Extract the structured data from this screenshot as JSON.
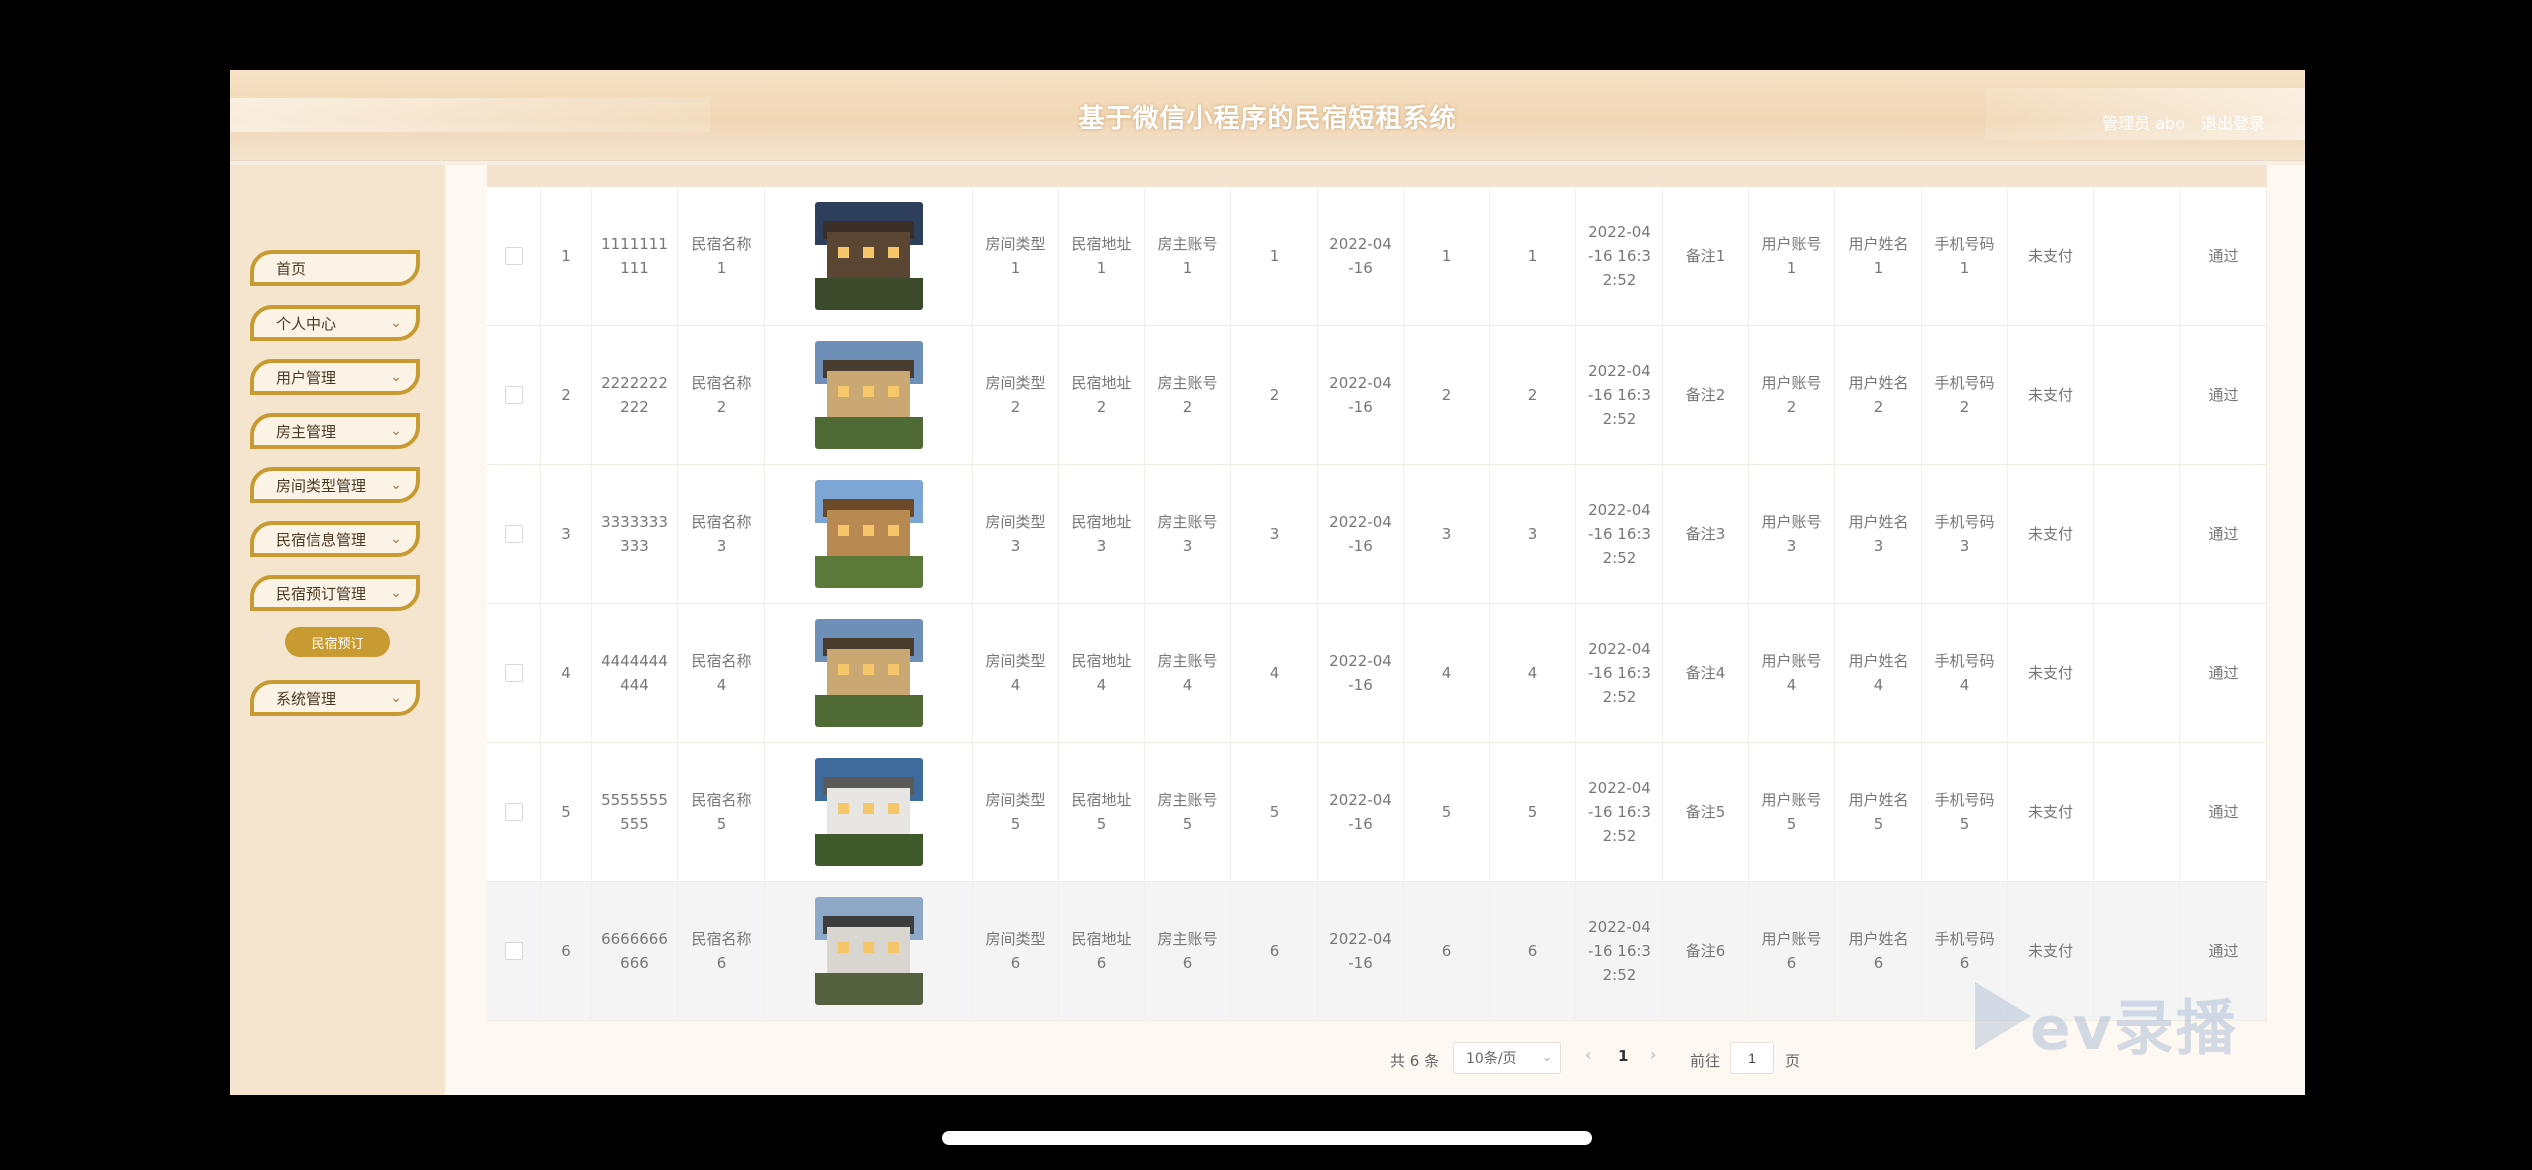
{
  "header": {
    "title": "基于微信小程序的民宿短租系统",
    "user": "管理员 abo",
    "logout": "退出登录"
  },
  "sidebar": {
    "items": [
      {
        "label": "首页",
        "chevron": ""
      },
      {
        "label": "个人中心",
        "chevron": "⌄"
      },
      {
        "label": "用户管理",
        "chevron": "⌄"
      },
      {
        "label": "房主管理",
        "chevron": "⌄"
      },
      {
        "label": "房间类型管理",
        "chevron": "⌄"
      },
      {
        "label": "民宿信息管理",
        "chevron": "⌄"
      },
      {
        "label": "民宿预订管理",
        "chevron": "⌄"
      },
      {
        "label": "系统管理",
        "chevron": "⌄"
      }
    ],
    "submenu": {
      "label": "民宿预订"
    }
  },
  "table": {
    "rows": [
      {
        "index": "1",
        "order_no": "1111111\n111",
        "name": "民宿名称\n1",
        "room_type": "房间类型\n1",
        "address": "民宿地址\n1",
        "owner": "房主账号\n1",
        "qty": "1",
        "date": "2022-04\n-16",
        "days": "1",
        "price": "1",
        "time": "2022-04\n-16 16:3\n2:52",
        "remark": "备注1",
        "user_account": "用户账号\n1",
        "user_name": "用户姓名\n1",
        "phone": "手机号码\n1",
        "pay": "未支付",
        "review": "",
        "status": "通过"
      },
      {
        "index": "2",
        "order_no": "2222222\n222",
        "name": "民宿名称\n2",
        "room_type": "房间类型\n2",
        "address": "民宿地址\n2",
        "owner": "房主账号\n2",
        "qty": "2",
        "date": "2022-04\n-16",
        "days": "2",
        "price": "2",
        "time": "2022-04\n-16 16:3\n2:52",
        "remark": "备注2",
        "user_account": "用户账号\n2",
        "user_name": "用户姓名\n2",
        "phone": "手机号码\n2",
        "pay": "未支付",
        "review": "",
        "status": "通过"
      },
      {
        "index": "3",
        "order_no": "3333333\n333",
        "name": "民宿名称\n3",
        "room_type": "房间类型\n3",
        "address": "民宿地址\n3",
        "owner": "房主账号\n3",
        "qty": "3",
        "date": "2022-04\n-16",
        "days": "3",
        "price": "3",
        "time": "2022-04\n-16 16:3\n2:52",
        "remark": "备注3",
        "user_account": "用户账号\n3",
        "user_name": "用户姓名\n3",
        "phone": "手机号码\n3",
        "pay": "未支付",
        "review": "",
        "status": "通过"
      },
      {
        "index": "4",
        "order_no": "4444444\n444",
        "name": "民宿名称\n4",
        "room_type": "房间类型\n4",
        "address": "民宿地址\n4",
        "owner": "房主账号\n4",
        "qty": "4",
        "date": "2022-04\n-16",
        "days": "4",
        "price": "4",
        "time": "2022-04\n-16 16:3\n2:52",
        "remark": "备注4",
        "user_account": "用户账号\n4",
        "user_name": "用户姓名\n4",
        "phone": "手机号码\n4",
        "pay": "未支付",
        "review": "",
        "status": "通过"
      },
      {
        "index": "5",
        "order_no": "5555555\n555",
        "name": "民宿名称\n5",
        "room_type": "房间类型\n5",
        "address": "民宿地址\n5",
        "owner": "房主账号\n5",
        "qty": "5",
        "date": "2022-04\n-16",
        "days": "5",
        "price": "5",
        "time": "2022-04\n-16 16:3\n2:52",
        "remark": "备注5",
        "user_account": "用户账号\n5",
        "user_name": "用户姓名\n5",
        "phone": "手机号码\n5",
        "pay": "未支付",
        "review": "",
        "status": "通过"
      },
      {
        "index": "6",
        "order_no": "6666666\n666",
        "name": "民宿名称\n6",
        "room_type": "房间类型\n6",
        "address": "民宿地址\n6",
        "owner": "房主账号\n6",
        "qty": "6",
        "date": "2022-04\n-16",
        "days": "6",
        "price": "6",
        "time": "2022-04\n-16 16:3\n2:52",
        "remark": "备注6",
        "user_account": "用户账号\n6",
        "user_name": "用户姓名\n6",
        "phone": "手机号码\n6",
        "pay": "未支付",
        "review": "",
        "status": "通过"
      }
    ]
  },
  "pagination": {
    "total": "共 6 条",
    "page_size": "10条/页",
    "current": "1",
    "goto_label": "前往",
    "goto_value": "1",
    "page_label": "页"
  },
  "watermark": "ev录播"
}
